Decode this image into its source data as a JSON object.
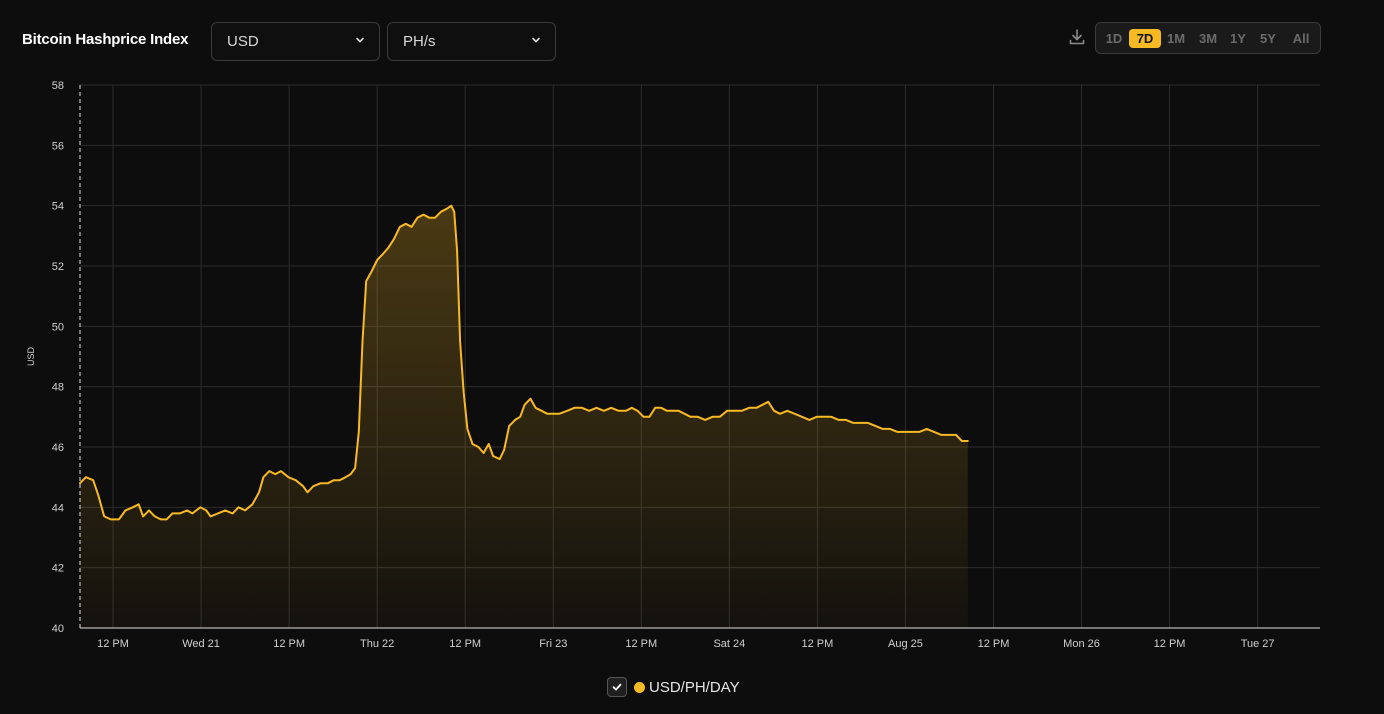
{
  "header": {
    "title": "Bitcoin Hashprice Index",
    "currency_select": "USD",
    "unit_select": "PH/s",
    "icons": {
      "dropdown": "chevron-down-icon",
      "download": "download-icon",
      "check": "check-icon"
    },
    "ranges": [
      "1D",
      "7D",
      "1M",
      "3M",
      "1Y",
      "5Y",
      "All"
    ],
    "active_range": "7D"
  },
  "colors": {
    "accent": "#f7b924",
    "background": "#0d0d0d",
    "grid": "#2c2c2c",
    "axis_text": "#d0d0d0"
  },
  "legend": {
    "label": "USD/PH/DAY",
    "checked": true
  },
  "chart_data": {
    "type": "area",
    "ylabel": "USD",
    "xlabel": "",
    "ylim": [
      40,
      58
    ],
    "yticks": [
      40,
      42,
      44,
      46,
      48,
      50,
      52,
      54,
      56,
      58
    ],
    "grid": true,
    "x_unit": "hours since Tue 20 Aug 07:30",
    "xlim": [
      0,
      169
    ],
    "xticks": [
      {
        "x": 4.5,
        "label": "12 PM"
      },
      {
        "x": 16.5,
        "label": "Wed 21"
      },
      {
        "x": 28.5,
        "label": "12 PM"
      },
      {
        "x": 40.5,
        "label": "Thu 22"
      },
      {
        "x": 52.5,
        "label": "12 PM"
      },
      {
        "x": 64.5,
        "label": "Fri 23"
      },
      {
        "x": 76.5,
        "label": "12 PM"
      },
      {
        "x": 88.5,
        "label": "Sat 24"
      },
      {
        "x": 100.5,
        "label": "12 PM"
      },
      {
        "x": 112.5,
        "label": "Aug 25"
      },
      {
        "x": 124.5,
        "label": "12 PM"
      },
      {
        "x": 136.5,
        "label": "Mon 26"
      },
      {
        "x": 148.5,
        "label": "12 PM"
      },
      {
        "x": 160.5,
        "label": "Tue 27"
      }
    ],
    "series": [
      {
        "name": "USD/PH/DAY",
        "color": "#f7b924",
        "points": [
          [
            0,
            44.8
          ],
          [
            0.8,
            45.0
          ],
          [
            1.8,
            44.9
          ],
          [
            2.5,
            44.4
          ],
          [
            3.3,
            43.7
          ],
          [
            4.2,
            43.6
          ],
          [
            5.3,
            43.6
          ],
          [
            6.2,
            43.9
          ],
          [
            7.2,
            44.0
          ],
          [
            8.0,
            44.1
          ],
          [
            8.6,
            43.7
          ],
          [
            9.4,
            43.9
          ],
          [
            10.2,
            43.7
          ],
          [
            11.0,
            43.6
          ],
          [
            11.8,
            43.6
          ],
          [
            12.6,
            43.8
          ],
          [
            13.6,
            43.8
          ],
          [
            14.6,
            43.9
          ],
          [
            15.3,
            43.8
          ],
          [
            16.4,
            44.0
          ],
          [
            17.2,
            43.9
          ],
          [
            17.8,
            43.7
          ],
          [
            18.8,
            43.8
          ],
          [
            19.8,
            43.9
          ],
          [
            20.8,
            43.8
          ],
          [
            21.6,
            44.0
          ],
          [
            22.5,
            43.9
          ],
          [
            23.5,
            44.1
          ],
          [
            24.4,
            44.5
          ],
          [
            25.0,
            45.0
          ],
          [
            25.8,
            45.2
          ],
          [
            26.6,
            45.1
          ],
          [
            27.4,
            45.2
          ],
          [
            28.4,
            45.0
          ],
          [
            29.4,
            44.9
          ],
          [
            30.4,
            44.7
          ],
          [
            31.0,
            44.5
          ],
          [
            31.8,
            44.7
          ],
          [
            32.8,
            44.8
          ],
          [
            33.8,
            44.8
          ],
          [
            34.6,
            44.9
          ],
          [
            35.4,
            44.9
          ],
          [
            36.2,
            45.0
          ],
          [
            36.9,
            45.1
          ],
          [
            37.5,
            45.3
          ],
          [
            38.0,
            46.5
          ],
          [
            38.5,
            49.5
          ],
          [
            39.0,
            51.5
          ],
          [
            39.7,
            51.8
          ],
          [
            40.5,
            52.2
          ],
          [
            41.3,
            52.4
          ],
          [
            42.0,
            52.6
          ],
          [
            42.8,
            52.9
          ],
          [
            43.6,
            53.3
          ],
          [
            44.4,
            53.4
          ],
          [
            45.2,
            53.3
          ],
          [
            46.0,
            53.6
          ],
          [
            46.8,
            53.7
          ],
          [
            47.6,
            53.6
          ],
          [
            48.4,
            53.6
          ],
          [
            49.2,
            53.8
          ],
          [
            50.0,
            53.9
          ],
          [
            50.6,
            54.0
          ],
          [
            51.0,
            53.8
          ],
          [
            51.4,
            52.5
          ],
          [
            51.8,
            49.5
          ],
          [
            52.3,
            47.8
          ],
          [
            52.8,
            46.6
          ],
          [
            53.5,
            46.1
          ],
          [
            54.3,
            46.0
          ],
          [
            55.0,
            45.8
          ],
          [
            55.7,
            46.1
          ],
          [
            56.3,
            45.7
          ],
          [
            57.2,
            45.6
          ],
          [
            57.8,
            45.9
          ],
          [
            58.5,
            46.7
          ],
          [
            59.3,
            46.9
          ],
          [
            60.0,
            47.0
          ],
          [
            60.6,
            47.4
          ],
          [
            61.4,
            47.6
          ],
          [
            62.1,
            47.3
          ],
          [
            62.9,
            47.2
          ],
          [
            63.7,
            47.1
          ],
          [
            64.5,
            47.1
          ],
          [
            65.3,
            47.1
          ],
          [
            66.4,
            47.2
          ],
          [
            67.4,
            47.3
          ],
          [
            68.4,
            47.3
          ],
          [
            69.4,
            47.2
          ],
          [
            70.4,
            47.3
          ],
          [
            71.4,
            47.2
          ],
          [
            72.4,
            47.3
          ],
          [
            73.4,
            47.2
          ],
          [
            74.4,
            47.2
          ],
          [
            75.2,
            47.3
          ],
          [
            76.0,
            47.2
          ],
          [
            76.8,
            47.0
          ],
          [
            77.6,
            47.0
          ],
          [
            78.4,
            47.3
          ],
          [
            79.2,
            47.3
          ],
          [
            80.0,
            47.2
          ],
          [
            80.8,
            47.2
          ],
          [
            81.6,
            47.2
          ],
          [
            82.4,
            47.1
          ],
          [
            83.2,
            47.0
          ],
          [
            84.2,
            47.0
          ],
          [
            85.2,
            46.9
          ],
          [
            86.2,
            47.0
          ],
          [
            87.2,
            47.0
          ],
          [
            88.2,
            47.2
          ],
          [
            89.2,
            47.2
          ],
          [
            90.2,
            47.2
          ],
          [
            91.2,
            47.3
          ],
          [
            92.2,
            47.3
          ],
          [
            93.0,
            47.4
          ],
          [
            93.8,
            47.5
          ],
          [
            94.6,
            47.2
          ],
          [
            95.4,
            47.1
          ],
          [
            96.4,
            47.2
          ],
          [
            97.4,
            47.1
          ],
          [
            98.4,
            47.0
          ],
          [
            99.4,
            46.9
          ],
          [
            100.4,
            47.0
          ],
          [
            101.4,
            47.0
          ],
          [
            102.4,
            47.0
          ],
          [
            103.4,
            46.9
          ],
          [
            104.4,
            46.9
          ],
          [
            105.4,
            46.8
          ],
          [
            106.4,
            46.8
          ],
          [
            107.4,
            46.8
          ],
          [
            108.4,
            46.7
          ],
          [
            109.4,
            46.6
          ],
          [
            110.4,
            46.6
          ],
          [
            111.4,
            46.5
          ],
          [
            112.4,
            46.5
          ],
          [
            113.4,
            46.5
          ],
          [
            114.4,
            46.5
          ],
          [
            115.4,
            46.6
          ],
          [
            116.4,
            46.5
          ],
          [
            117.4,
            46.4
          ],
          [
            118.4,
            46.4
          ],
          [
            119.4,
            46.4
          ],
          [
            120.2,
            46.2
          ],
          [
            121.0,
            46.2
          ]
        ]
      }
    ]
  }
}
